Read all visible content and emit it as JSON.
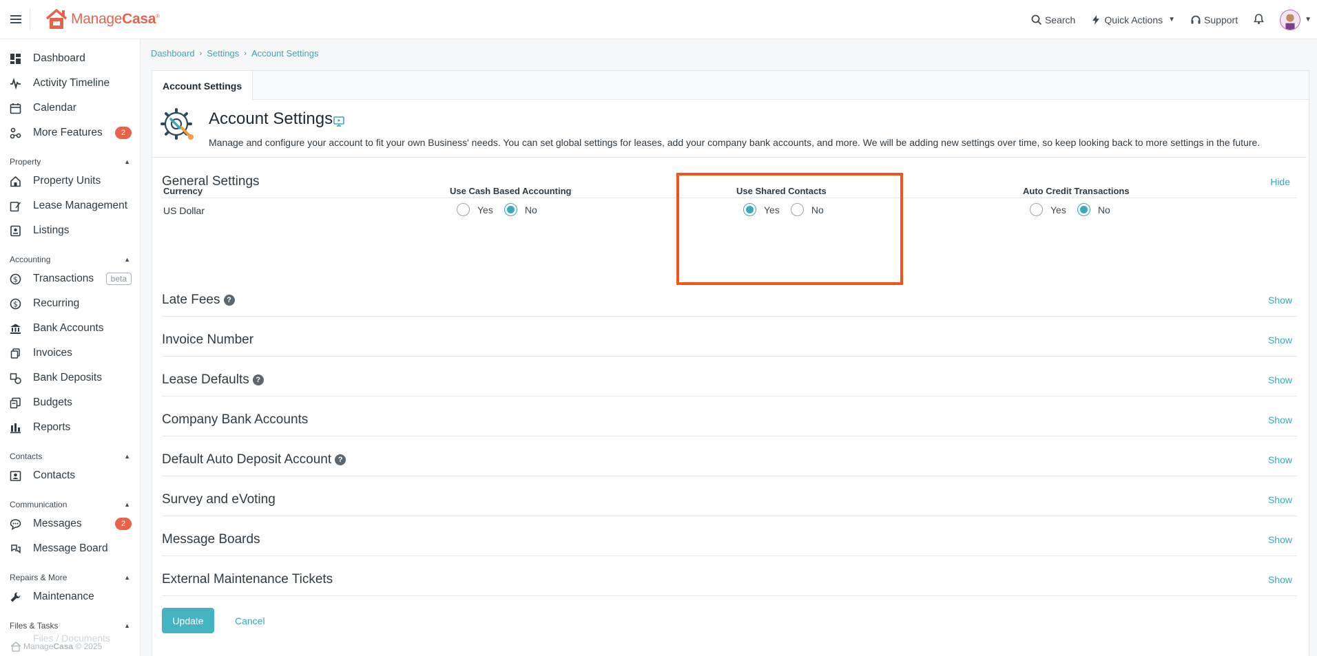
{
  "brand": {
    "name_light": "Manage",
    "name_bold": "Casa",
    "mark": "®"
  },
  "topbar": {
    "search_label": "Search",
    "quick_actions_label": "Quick Actions",
    "support_label": "Support"
  },
  "sidebar": {
    "top_items": [
      {
        "label": "Dashboard",
        "icon": "dashboard-icon"
      },
      {
        "label": "Activity Timeline",
        "icon": "activity-icon"
      },
      {
        "label": "Calendar",
        "icon": "calendar-icon"
      },
      {
        "label": "More Features",
        "icon": "features-icon",
        "badge": "2"
      }
    ],
    "groups": [
      {
        "title": "Property",
        "items": [
          {
            "label": "Property Units"
          },
          {
            "label": "Lease Management"
          },
          {
            "label": "Listings"
          }
        ]
      },
      {
        "title": "Accounting",
        "items": [
          {
            "label": "Transactions",
            "tag": "beta"
          },
          {
            "label": "Recurring"
          },
          {
            "label": "Bank Accounts"
          },
          {
            "label": "Invoices"
          },
          {
            "label": "Bank Deposits"
          },
          {
            "label": "Budgets"
          },
          {
            "label": "Reports"
          }
        ]
      },
      {
        "title": "Contacts",
        "items": [
          {
            "label": "Contacts"
          }
        ]
      },
      {
        "title": "Communication",
        "items": [
          {
            "label": "Messages",
            "badge": "2"
          },
          {
            "label": "Message Board"
          }
        ]
      },
      {
        "title": "Repairs & More",
        "items": [
          {
            "label": "Maintenance"
          }
        ]
      },
      {
        "title": "Files & Tasks",
        "items": [
          {
            "label": "Files / Documents"
          }
        ]
      }
    ],
    "footer": {
      "light": "Manage",
      "bold": "Casa",
      "year": "© 2025"
    }
  },
  "breadcrumb": [
    "Dashboard",
    "Settings",
    "Account Settings"
  ],
  "tab_label": "Account Settings",
  "page": {
    "title": "Account Settings",
    "description": "Manage and configure your account to fit your own Business' needs. You can set global settings for leases, add your company bank accounts, and more. We will be adding new settings over time, so keep looking back to more settings in the future."
  },
  "general": {
    "title": "General Settings",
    "toggle": "Hide",
    "currency": {
      "label": "Currency",
      "value": "US Dollar"
    },
    "cash_accounting": {
      "label": "Use Cash Based Accounting",
      "yes": "Yes",
      "no": "No",
      "selected": "No"
    },
    "shared_contacts": {
      "label": "Use Shared Contacts",
      "yes": "Yes",
      "no": "No",
      "selected": "Yes"
    },
    "auto_credit": {
      "label": "Auto Credit Transactions",
      "yes": "Yes",
      "no": "No",
      "selected": "No"
    }
  },
  "sections": [
    {
      "title": "Late Fees",
      "help": true,
      "toggle": "Show"
    },
    {
      "title": "Invoice Number",
      "help": false,
      "toggle": "Show"
    },
    {
      "title": "Lease Defaults",
      "help": true,
      "toggle": "Show"
    },
    {
      "title": "Company Bank Accounts",
      "help": false,
      "toggle": "Show"
    },
    {
      "title": "Default Auto Deposit Account",
      "help": true,
      "toggle": "Show"
    },
    {
      "title": "Survey and eVoting",
      "help": false,
      "toggle": "Show"
    },
    {
      "title": "Message Boards",
      "help": false,
      "toggle": "Show"
    },
    {
      "title": "External Maintenance Tickets",
      "help": false,
      "toggle": "Show"
    }
  ],
  "actions": {
    "update": "Update",
    "cancel": "Cancel"
  },
  "colors": {
    "accent": "#3aa9b8",
    "brand": "#e8634a",
    "highlight": "#f0561c"
  }
}
